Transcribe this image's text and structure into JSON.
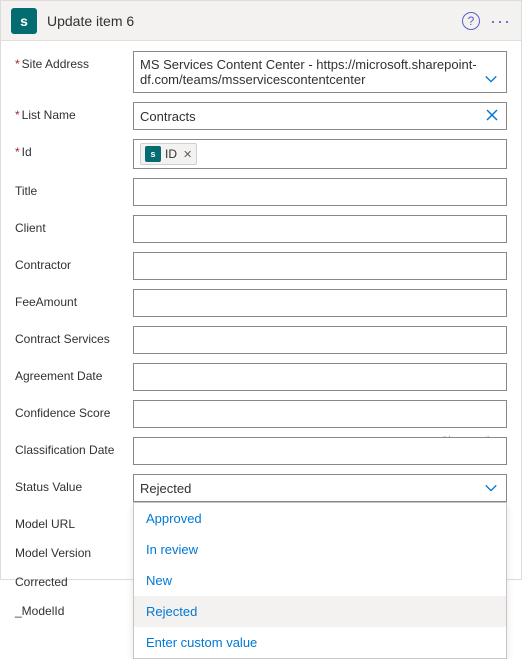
{
  "header": {
    "app_icon_letter": "s",
    "title": "Update item 6"
  },
  "fields": {
    "site_address": {
      "label": "Site Address",
      "required": true,
      "value": "MS Services Content Center - https://microsoft.sharepoint-df.com/teams/msservicescontentcenter"
    },
    "list_name": {
      "label": "List Name",
      "required": true,
      "value": "Contracts"
    },
    "id": {
      "label": "Id",
      "required": true,
      "token_label": "ID"
    },
    "title": {
      "label": "Title",
      "value": ""
    },
    "client": {
      "label": "Client",
      "value": ""
    },
    "contractor": {
      "label": "Contractor",
      "value": ""
    },
    "fee_amount": {
      "label": "FeeAmount",
      "value": ""
    },
    "contract_services": {
      "label": "Contract Services",
      "value": ""
    },
    "agreement_date": {
      "label": "Agreement Date",
      "value": ""
    },
    "confidence_score": {
      "label": "Confidence Score",
      "value": ""
    },
    "classification_date": {
      "label": "Classification Date",
      "value": "",
      "hint": "Show options"
    },
    "status_value": {
      "label": "Status Value",
      "value": "Rejected",
      "options": [
        "Approved",
        "In review",
        "New",
        "Rejected",
        "Enter custom value"
      ]
    },
    "model_url": {
      "label": "Model URL"
    },
    "model_version": {
      "label": "Model Version"
    },
    "corrected": {
      "label": "Corrected"
    },
    "model_id": {
      "label": "_ModelId"
    }
  }
}
